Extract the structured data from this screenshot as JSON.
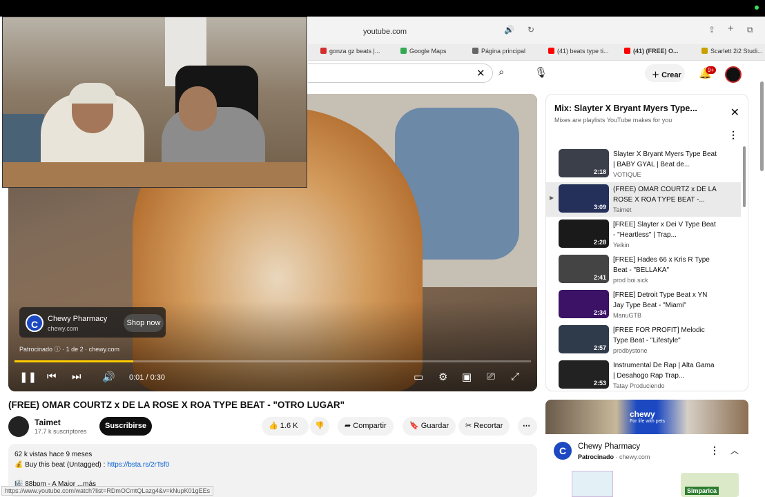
{
  "browser": {
    "url": "youtube.com",
    "tabs": [
      {
        "label": "gonza gz beats |...",
        "color": "#d32f2f"
      },
      {
        "label": "Google Maps",
        "color": "#34a853"
      },
      {
        "label": "Página principal",
        "color": "#666666"
      },
      {
        "label": "(41) beats type ti...",
        "color": "#ff0000"
      },
      {
        "label": "(41) (FREE) O...",
        "color": "#ff0000"
      },
      {
        "label": "Scarlett 2i2 Studi...",
        "color": "#c8a000"
      }
    ]
  },
  "header": {
    "create_label": "Crear",
    "notif_count": "9+"
  },
  "player": {
    "ad_name": "Chewy Pharmacy",
    "ad_url": "chewy.com",
    "ad_cta": "Shop now",
    "sponsored": "Patrocinado",
    "ad_position": "1 de 2",
    "ad_domain": "chewy.com",
    "time": "0:01 / 0:30",
    "progress": 0.23
  },
  "video": {
    "title": "(FREE) OMAR COURTZ x DE LA ROSE X ROA TYPE BEAT - \"OTRO LUGAR\"",
    "channel": "Taimet",
    "subs": "17.7 k suscriptores",
    "subscribe_label": "Suscribirse",
    "likes": "1.6 K",
    "share_label": "Compartir",
    "save_label": "Guardar",
    "clip_label": "Recortar",
    "views": "62 k vistas  hace 9 meses",
    "buy_text": "💰 Buy this beat (Untagged) : ",
    "buy_link": "https://bsta.rs/2rTsf0",
    "bpm_text": "🎼 88bpm - A Major  ...más"
  },
  "status_url": "https://www.youtube.com/watch?list=RDmOCmtQLazg4&v=kNupK01gEEs",
  "playlist": {
    "title": "Mix: Slayter X Bryant Myers Type...",
    "subtitle": "Mixes are playlists YouTube makes for you",
    "items": [
      {
        "title": "Slayter X Bryant Myers Type Beat | BABY GYAL | Beat de...",
        "channel": "VOTIQUE",
        "duration": "2:18",
        "thumb": "#3a3f4a",
        "active": false
      },
      {
        "title": "(FREE) OMAR COURTZ x DE LA ROSE X ROA TYPE BEAT -...",
        "channel": "Taimet",
        "duration": "3:09",
        "thumb": "#24305a",
        "active": true
      },
      {
        "title": "[FREE] Slayter x Dei V Type Beat - \"Heartless\" | Trap...",
        "channel": "Yeikin",
        "duration": "2:28",
        "thumb": "#1a1a1a",
        "active": false
      },
      {
        "title": "[FREE] Hades 66 x Kris R Type Beat - \"BELLAKA\"",
        "channel": "prod boi sick",
        "duration": "2:41",
        "thumb": "#444444",
        "active": false
      },
      {
        "title": "[FREE] Detroit Type Beat x YN Jay Type Beat - \"Miami\"",
        "channel": "ManuGTB",
        "duration": "2:34",
        "thumb": "#3b1266",
        "active": false
      },
      {
        "title": "[FREE FOR PROFIT] Melodic Type Beat - \"Lifestyle\"",
        "channel": "prodbystone",
        "duration": "2:57",
        "thumb": "#2f3b4a",
        "active": false
      },
      {
        "title": "Instrumental De Rap | Alta Gama | Desahogo Rap Trap...",
        "channel": "Tatay Produciendo",
        "duration": "2:53",
        "thumb": "#222222",
        "active": false
      }
    ]
  },
  "adpanel": {
    "banner_brand": "chewy",
    "banner_tag": "For life with pets",
    "name": "Chewy Pharmacy",
    "sponsored": "Patrocinado",
    "domain": "· chewy.com",
    "product": "Simparica"
  }
}
